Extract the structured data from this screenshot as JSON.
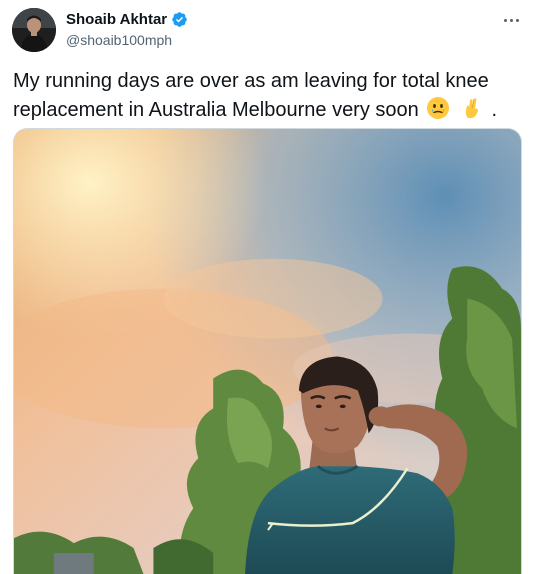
{
  "author": {
    "display_name": "Shoaib Akhtar",
    "handle": "@shoaib100mph",
    "verified": true
  },
  "tweet": {
    "text_main": "My running days are over as am leaving for total knee replacement in Australia Melbourne very soon",
    "text_end": ".",
    "emojis": [
      "face-holding-back-tears-emoji",
      "crossed-fingers-emoji"
    ]
  },
  "media": {
    "description_icon": "photo"
  },
  "colors": {
    "verified": "#1d9bf0",
    "secondary_text": "#536471",
    "primary_text": "#0f1419",
    "border": "#cfd9de"
  },
  "icons": {
    "more": "more-options-icon",
    "verified": "verified-badge-icon"
  }
}
